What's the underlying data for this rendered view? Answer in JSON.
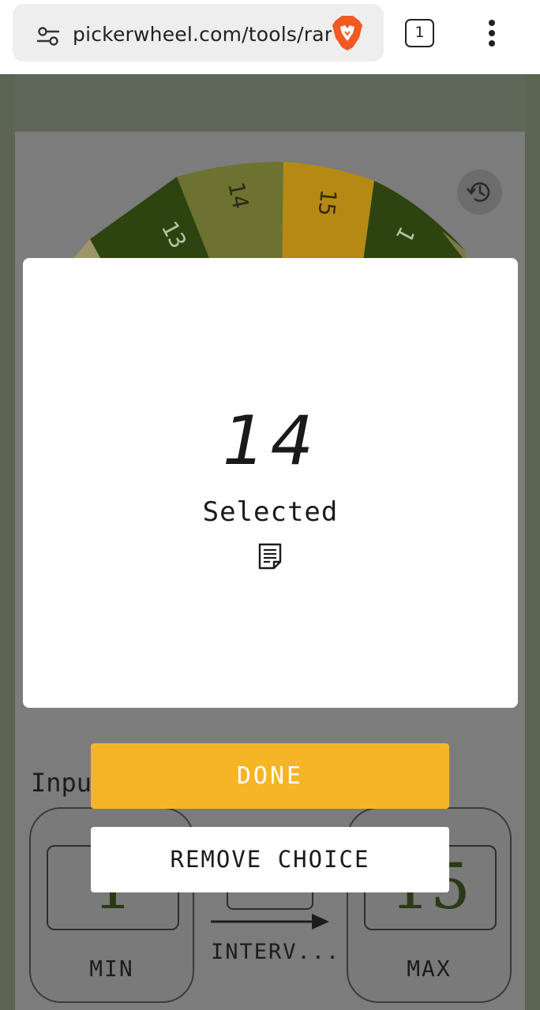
{
  "browser": {
    "url": "pickerwheel.com/tools/rar",
    "tab_count": "1",
    "icons": [
      "site-settings-icon",
      "brave-lion-icon",
      "tabs-icon",
      "menu-dots-icon"
    ]
  },
  "wheel": {
    "visible_segments": [
      "13",
      "14",
      "15",
      "1"
    ],
    "colors": [
      "#7a7a4a",
      "#2e4410",
      "#6e7230",
      "#b58a14"
    ],
    "history_icon": "history-icon"
  },
  "background_form": {
    "input_label": "Input",
    "min_value": "1",
    "min_caption": "MIN",
    "max_value": "15",
    "max_caption": "MAX",
    "interval_caption": "INTERV..."
  },
  "modal": {
    "result": "14",
    "status": "Selected",
    "note_icon": "note-icon"
  },
  "actions": {
    "done_label": "DONE",
    "remove_label": "REMOVE CHOICE",
    "done_color": "#f6b527"
  }
}
